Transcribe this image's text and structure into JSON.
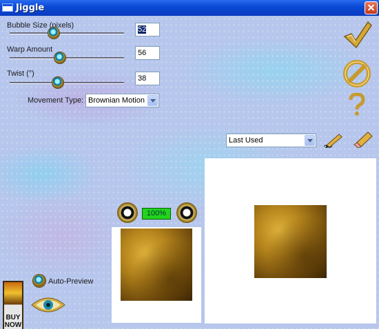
{
  "window": {
    "title": "Jiggle"
  },
  "controls": {
    "bubble_size": {
      "label": "Bubble Size (pixels)",
      "value": "52",
      "level": 0.52
    },
    "warp_amount": {
      "label": "Warp Amount",
      "value": "56",
      "level": 0.56
    },
    "twist": {
      "label": "Twist (°)",
      "value": "38",
      "level": 0.38
    },
    "movement_type": {
      "label": "Movement Type:",
      "selected": "Brownian Motion"
    }
  },
  "presets": {
    "selected": "Last Used"
  },
  "zoom": {
    "level": "100%"
  },
  "auto_preview": {
    "label": "Auto-Preview"
  },
  "buy_now": {
    "line1": "BUY",
    "line2": "NOW"
  },
  "icons": {
    "ok": "checkmark-icon",
    "cancel": "no-entry-icon",
    "help": "question-mark-icon",
    "save_preset": "pencil-icon",
    "delete_preset": "eraser-icon",
    "zoom_out": "eye-zoom-out-icon",
    "zoom_in": "eye-zoom-in-icon",
    "eye": "eye-icon"
  },
  "colors": {
    "gold": "#c8a030",
    "title_blue": "#0a4ad6",
    "zoom_green": "#22d41c"
  }
}
